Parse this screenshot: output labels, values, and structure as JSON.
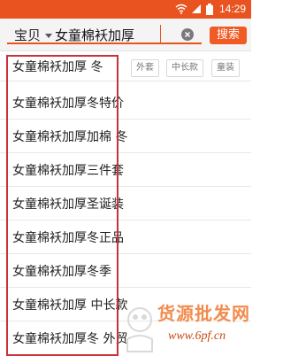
{
  "status_bar": {
    "time": "14:29",
    "icons": [
      "wifi-icon",
      "signal-icon",
      "battery-icon"
    ],
    "color": "#e8531f"
  },
  "search": {
    "scope": "宝贝",
    "query": "女童棉袄加厚",
    "button_label": "搜索",
    "accent_color": "#f05a24"
  },
  "filters": [
    "外套",
    "中长款",
    "童装"
  ],
  "suggestions": [
    "女童棉袄加厚 冬",
    "女童棉袄加厚冬特价",
    "女童棉袄加厚加棉 冬",
    "女童棉袄加厚三件套",
    "女童棉袄加厚圣诞装",
    "女童棉袄加厚冬正品",
    "女童棉袄加厚冬季",
    "女童棉袄加厚 中长款",
    "女童棉袄加厚冬 外贸"
  ],
  "watermark": {
    "text": "货源批发网",
    "url": "www.6pf.cn"
  }
}
